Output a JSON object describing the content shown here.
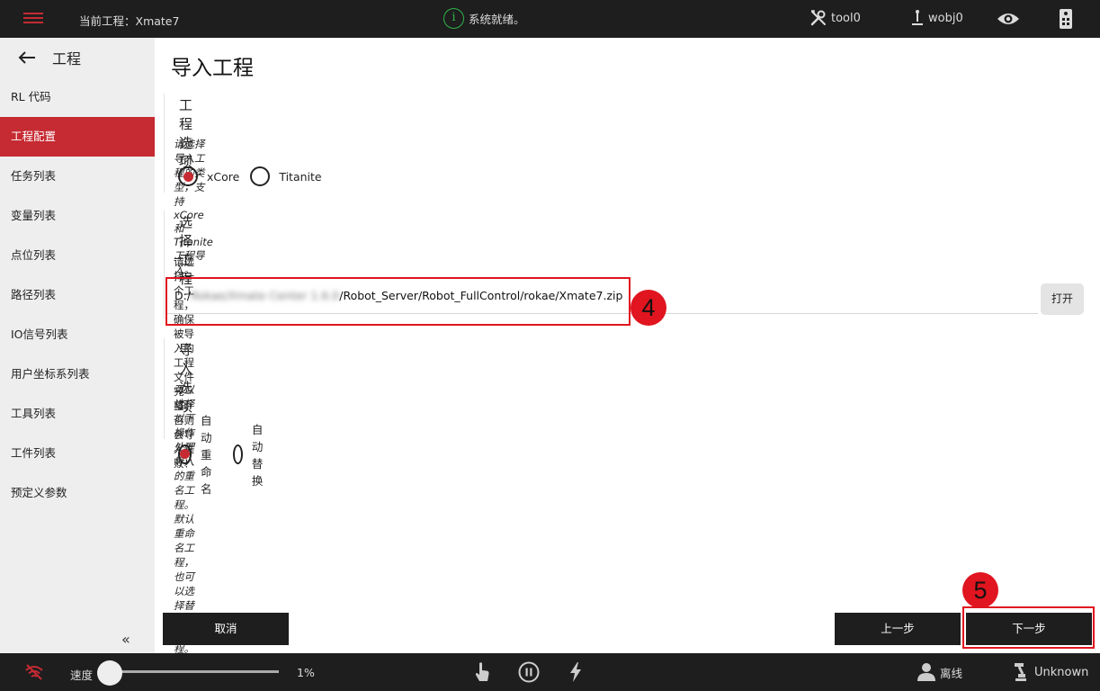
{
  "topbar": {
    "menu_icon": "hamburger-menu-icon",
    "project_label": "当前工程：Xmate7",
    "status_text": "系统就绪。",
    "status_icon": "info-circle-icon",
    "tool_label": "tool0",
    "wobj_label": "wobj0",
    "accent_color": "#c62a32",
    "status_color": "#2fb34a"
  },
  "sidebar": {
    "back_icon": "arrow-left-icon",
    "title": "工程",
    "items": [
      {
        "label": "RL 代码",
        "active": false
      },
      {
        "label": "工程配置",
        "active": true
      },
      {
        "label": "任务列表",
        "active": false
      },
      {
        "label": "变量列表",
        "active": false
      },
      {
        "label": "点位列表",
        "active": false
      },
      {
        "label": "路径列表",
        "active": false
      },
      {
        "label": "IO信号列表",
        "active": false
      },
      {
        "label": "用户坐标系列表",
        "active": false
      },
      {
        "label": "工具列表",
        "active": false
      },
      {
        "label": "工件列表",
        "active": false
      },
      {
        "label": "预定义参数",
        "active": false
      }
    ],
    "collapse_label": "«"
  },
  "main": {
    "page_title": "导入工程",
    "project_options": {
      "title": "工程选项",
      "description": "请选择导入工程的类型，支持xCore和Titanite工程导入。",
      "options": [
        {
          "label": "xCore",
          "checked": true
        },
        {
          "label": "Titanite",
          "checked": false
        }
      ]
    },
    "select_project": {
      "title": "选择工程",
      "description": "请选择一个工程，确保被导入的工程文件完整，否则会导入失败！",
      "path_prefix": "D:/",
      "path_blurred": "Rokae/Xmate Center 1.6.0",
      "path_suffix": "/Robot_Server/Robot_FullControl/rokae/Xmate7.zip",
      "open_label": "打开"
    },
    "import_options": {
      "title": "导入选项",
      "description": "可以选择以下操作处理导入的重名工程。默认重命名工程，也可以选择替换已有工程。",
      "options": [
        {
          "label": "自动重命名",
          "checked": true
        },
        {
          "label": "自动替换",
          "checked": false
        }
      ]
    },
    "cancel_label": "取消",
    "prev_label": "上一步",
    "next_label": "下一步",
    "step_badges": [
      "4",
      "5"
    ],
    "annotation_color": "#e0151f"
  },
  "bottombar": {
    "speed_label": "速度",
    "speed_value": "1%",
    "speed_fraction": 0.01,
    "offline_label": "离线",
    "unknown_label": "Unknown"
  }
}
